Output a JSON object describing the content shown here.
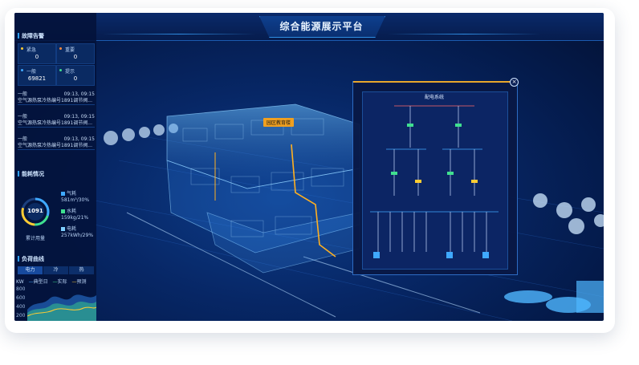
{
  "header": {
    "title": "综合能源展示平台"
  },
  "alarms": {
    "section_title": "故障告警",
    "counters": [
      {
        "label": "紧急",
        "value": "0",
        "color": "#ffcc33"
      },
      {
        "label": "重要",
        "value": "0",
        "color": "#ff8a3d"
      },
      {
        "label": "一般",
        "value": "69821",
        "color": "#3fa9ff"
      },
      {
        "label": "提示",
        "value": "0",
        "color": "#3fe08f"
      }
    ],
    "logs": [
      {
        "level": "一般",
        "time": "09:13, 09:15",
        "text": "空气源热泵冷热编号1891调节阀..."
      },
      {
        "level": "一般",
        "time": "09:13, 09:15",
        "text": "空气源热泵冷热编号1891调节阀..."
      },
      {
        "level": "一般",
        "time": "09:13, 09:15",
        "text": "空气源热泵冷热编号1891调节阀..."
      }
    ]
  },
  "energy": {
    "section_title": "能耗情况",
    "gauge_value": "1091",
    "gauge_label": "累计用量",
    "items": [
      {
        "name": "气耗",
        "value": "581m³/30%",
        "color": "#3fa9ff"
      },
      {
        "name": "水耗",
        "value": "159kg/21%",
        "color": "#3fe08f"
      },
      {
        "name": "电耗",
        "value": "257kWh/29%",
        "color": "#7fd0ff"
      }
    ]
  },
  "curves": {
    "section_title": "负荷曲线",
    "tabs": [
      "电力",
      "冷",
      "热"
    ],
    "unit": "KW",
    "legend": [
      "典型日",
      "实际",
      "预测"
    ],
    "yticks": [
      "800",
      "600",
      "400",
      "200"
    ]
  },
  "scene": {
    "building_tag": "园区教育楼"
  },
  "popup": {
    "close_symbol": "×",
    "diagram_title": "配电系统"
  }
}
